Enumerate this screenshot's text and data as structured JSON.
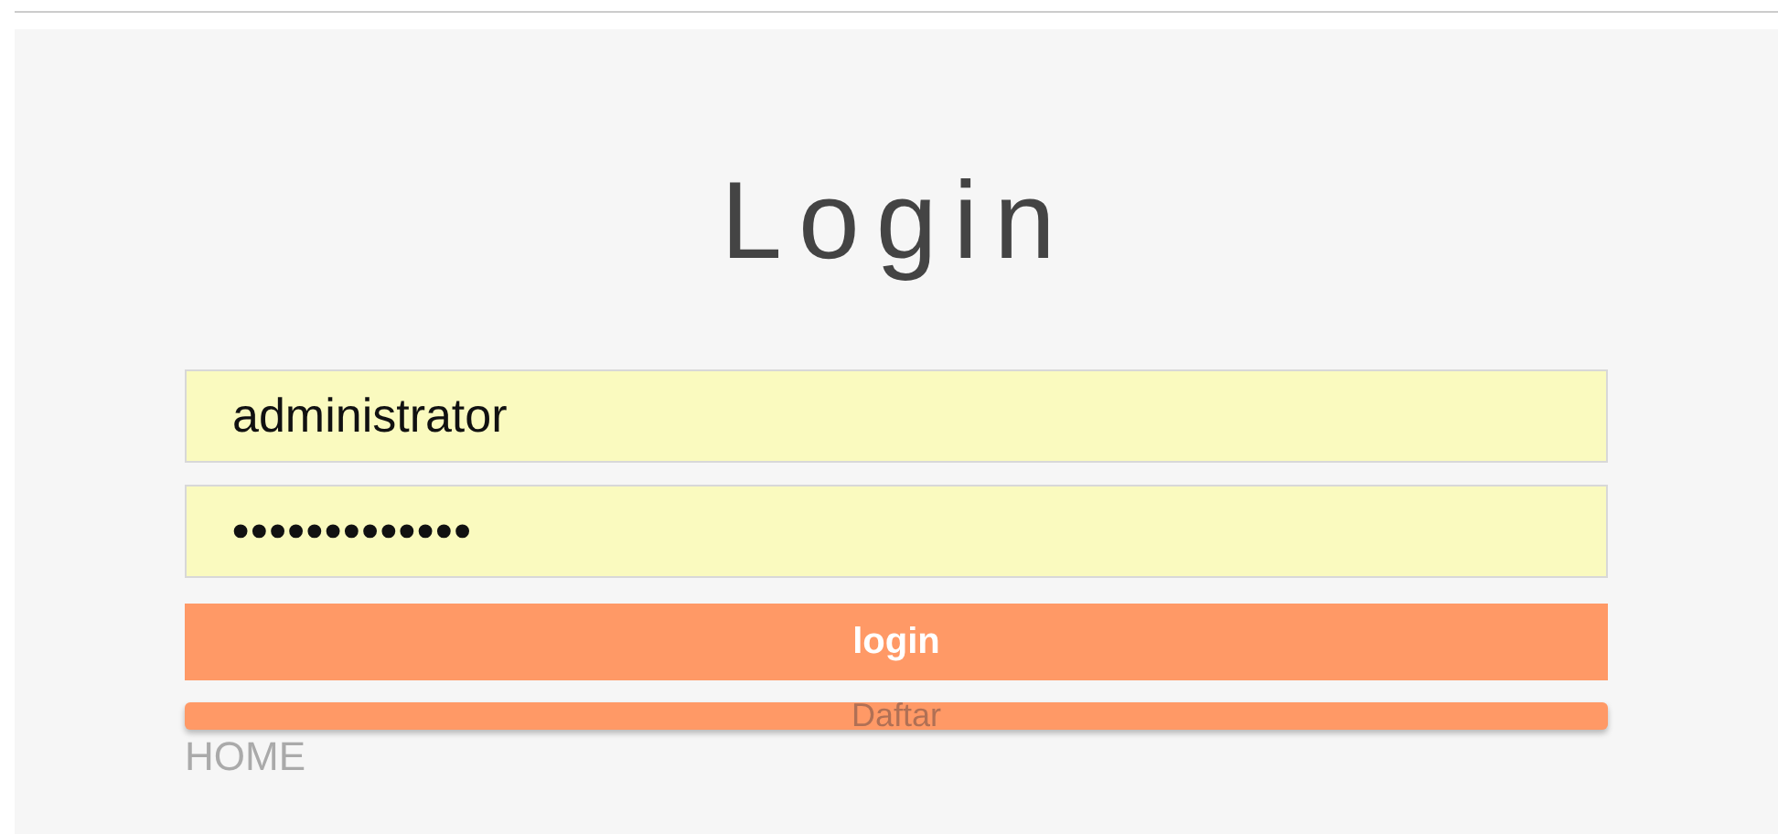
{
  "title": "Login",
  "fields": [
    {
      "kind": "text",
      "value": "administrator"
    },
    {
      "kind": "password",
      "value": "•••••••••••••"
    }
  ],
  "buttons": [
    {
      "kind": "primary",
      "label": "login"
    },
    {
      "kind": "secondary",
      "label": "Daftar"
    }
  ],
  "link": "HOME"
}
